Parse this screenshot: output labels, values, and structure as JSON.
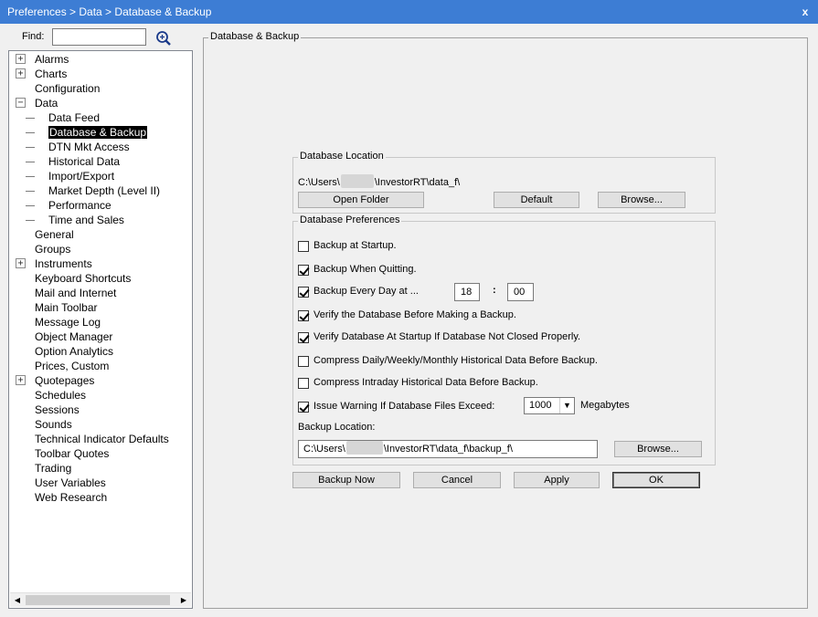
{
  "window": {
    "title": "Preferences > Data > Database & Backup",
    "close": "x"
  },
  "find": {
    "label": "Find:",
    "value": ""
  },
  "tree": {
    "items": [
      {
        "label": "Alarms",
        "expander": "+"
      },
      {
        "label": "Charts",
        "expander": "+"
      },
      {
        "label": "Configuration"
      },
      {
        "label": "Data",
        "expander": "−"
      },
      {
        "label": "Data Feed"
      },
      {
        "label": "Database & Backup",
        "selected": true
      },
      {
        "label": "DTN Mkt Access"
      },
      {
        "label": "Historical Data"
      },
      {
        "label": "Import/Export"
      },
      {
        "label": "Market Depth (Level II)"
      },
      {
        "label": "Performance"
      },
      {
        "label": "Time and Sales"
      },
      {
        "label": "General"
      },
      {
        "label": "Groups"
      },
      {
        "label": "Instruments",
        "expander": "+"
      },
      {
        "label": "Keyboard Shortcuts"
      },
      {
        "label": "Mail and Internet"
      },
      {
        "label": "Main Toolbar"
      },
      {
        "label": "Message Log"
      },
      {
        "label": "Object Manager"
      },
      {
        "label": "Option Analytics"
      },
      {
        "label": "Prices, Custom"
      },
      {
        "label": "Quotepages",
        "expander": "+"
      },
      {
        "label": "Schedules"
      },
      {
        "label": "Sessions"
      },
      {
        "label": "Sounds"
      },
      {
        "label": "Technical Indicator Defaults"
      },
      {
        "label": "Toolbar Quotes"
      },
      {
        "label": "Trading"
      },
      {
        "label": "User Variables"
      },
      {
        "label": "Web Research"
      }
    ],
    "scroll_left": "◀",
    "scroll_right": "▶"
  },
  "panel": {
    "title": "Database & Backup"
  },
  "db_location": {
    "title": "Database Location",
    "path_prefix": "C:\\Users\\",
    "path_suffix": "\\InvestorRT\\data_f\\",
    "open_folder": "Open Folder",
    "default": "Default",
    "browse": "Browse..."
  },
  "db_prefs": {
    "title": "Database Preferences",
    "checkboxes": [
      {
        "label": "Backup at Startup.",
        "checked": false
      },
      {
        "label": "Backup When Quitting.",
        "checked": true
      },
      {
        "label": "Backup Every Day at ...",
        "checked": true
      },
      {
        "label": "Verify the Database Before Making a Backup.",
        "checked": true
      },
      {
        "label": "Verify Database At Startup If Database Not Closed Properly.",
        "checked": true
      },
      {
        "label": "Compress Daily/Weekly/Monthly Historical Data Before Backup.",
        "checked": false
      },
      {
        "label": "Compress Intraday Historical Data Before Backup.",
        "checked": false
      },
      {
        "label": "Issue Warning If Database Files Exceed:",
        "checked": true
      }
    ],
    "hour": "18",
    "colon": ":",
    "minute": "00",
    "size_limit": "1000",
    "size_unit": "Megabytes",
    "backup_location_label": "Backup Location:",
    "backup_path_prefix": "C:\\Users\\",
    "backup_path_suffix": "\\InvestorRT\\data_f\\backup_f\\",
    "browse": "Browse..."
  },
  "buttons": {
    "backup_now": "Backup Now",
    "cancel": "Cancel",
    "apply": "Apply",
    "ok": "OK"
  }
}
